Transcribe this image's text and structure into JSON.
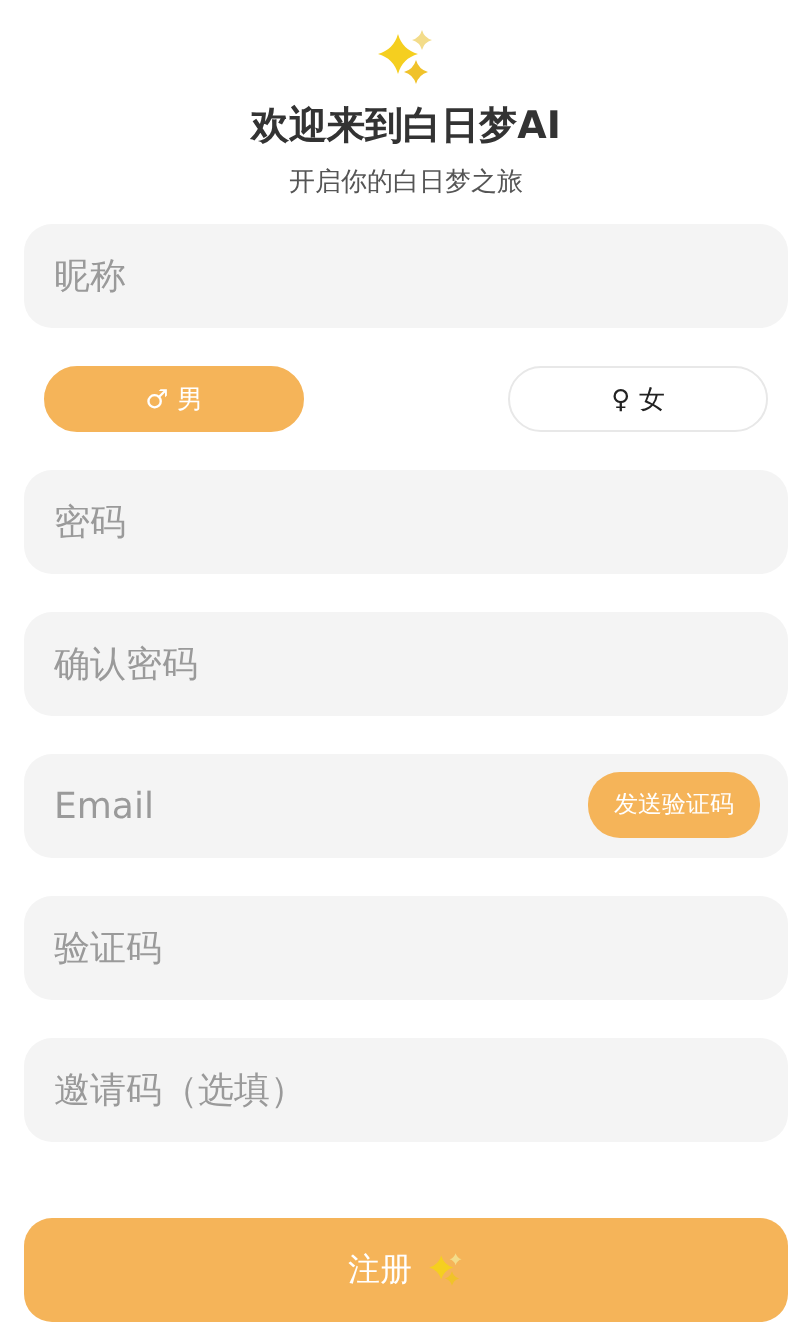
{
  "header": {
    "title": "欢迎来到白日梦AI",
    "subtitle": "开启你的白日梦之旅"
  },
  "nickname": {
    "placeholder": "昵称"
  },
  "gender": [
    {
      "symbol": "♂",
      "label": "男",
      "selected": true
    },
    {
      "symbol": "♀",
      "label": "女",
      "selected": false
    }
  ],
  "fields": [
    {
      "placeholder": "密码"
    },
    {
      "placeholder": "确认密码"
    },
    {
      "placeholder": "Email",
      "action": "发送验证码"
    },
    {
      "placeholder": "验证码"
    },
    {
      "placeholder": "邀请码（选填）"
    }
  ],
  "submit": {
    "label": "注册"
  }
}
